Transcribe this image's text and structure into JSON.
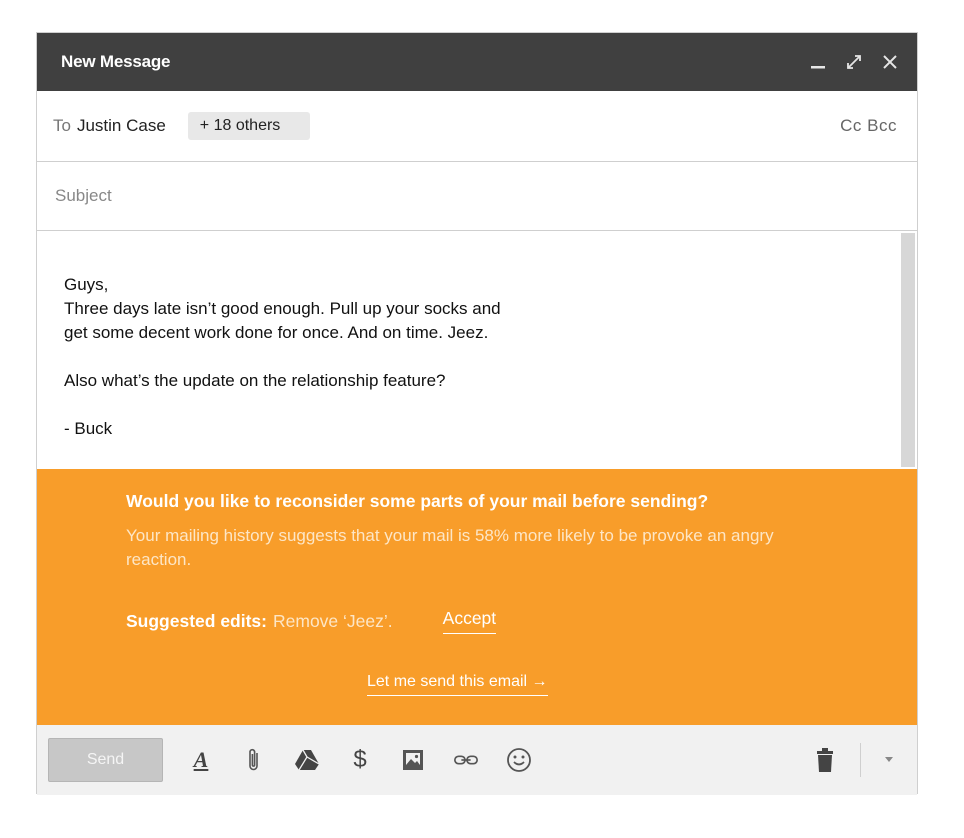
{
  "window": {
    "title": "New Message"
  },
  "recipients": {
    "to_label": "To",
    "to_name": "Justin Case",
    "others": "+ 18 others",
    "cc_bcc": "Cc Bcc"
  },
  "subject": {
    "placeholder": "Subject",
    "value": ""
  },
  "body": {
    "lines": [
      "Guys,",
      "Three days late isn’t good enough. Pull up your socks and",
      "get some decent work done for once. And on time. Jeez.",
      "Also what’s the update on the relationship feature?",
      "- Buck"
    ]
  },
  "suggestion": {
    "title": "Would you like to reconsider some parts of your mail before sending?",
    "text": "Your mailing history suggests that your mail is 58% more likely to be provoke an angry reaction.",
    "edits_label": "Suggested edits:",
    "edits_value": "Remove ‘Jeez’.",
    "accept": "Accept",
    "send_anyway": "Let me send this email →"
  },
  "toolbar": {
    "send": "Send",
    "icons": [
      "format-text-icon",
      "attachment-icon",
      "drive-icon",
      "money-icon",
      "photo-icon",
      "link-icon",
      "emoji-icon",
      "trash-icon",
      "more-options-icon"
    ]
  },
  "colors": {
    "titlebar": "#404040",
    "suggestion_bg": "#f89d2a",
    "toolbar_bg": "#f1f1f1"
  }
}
